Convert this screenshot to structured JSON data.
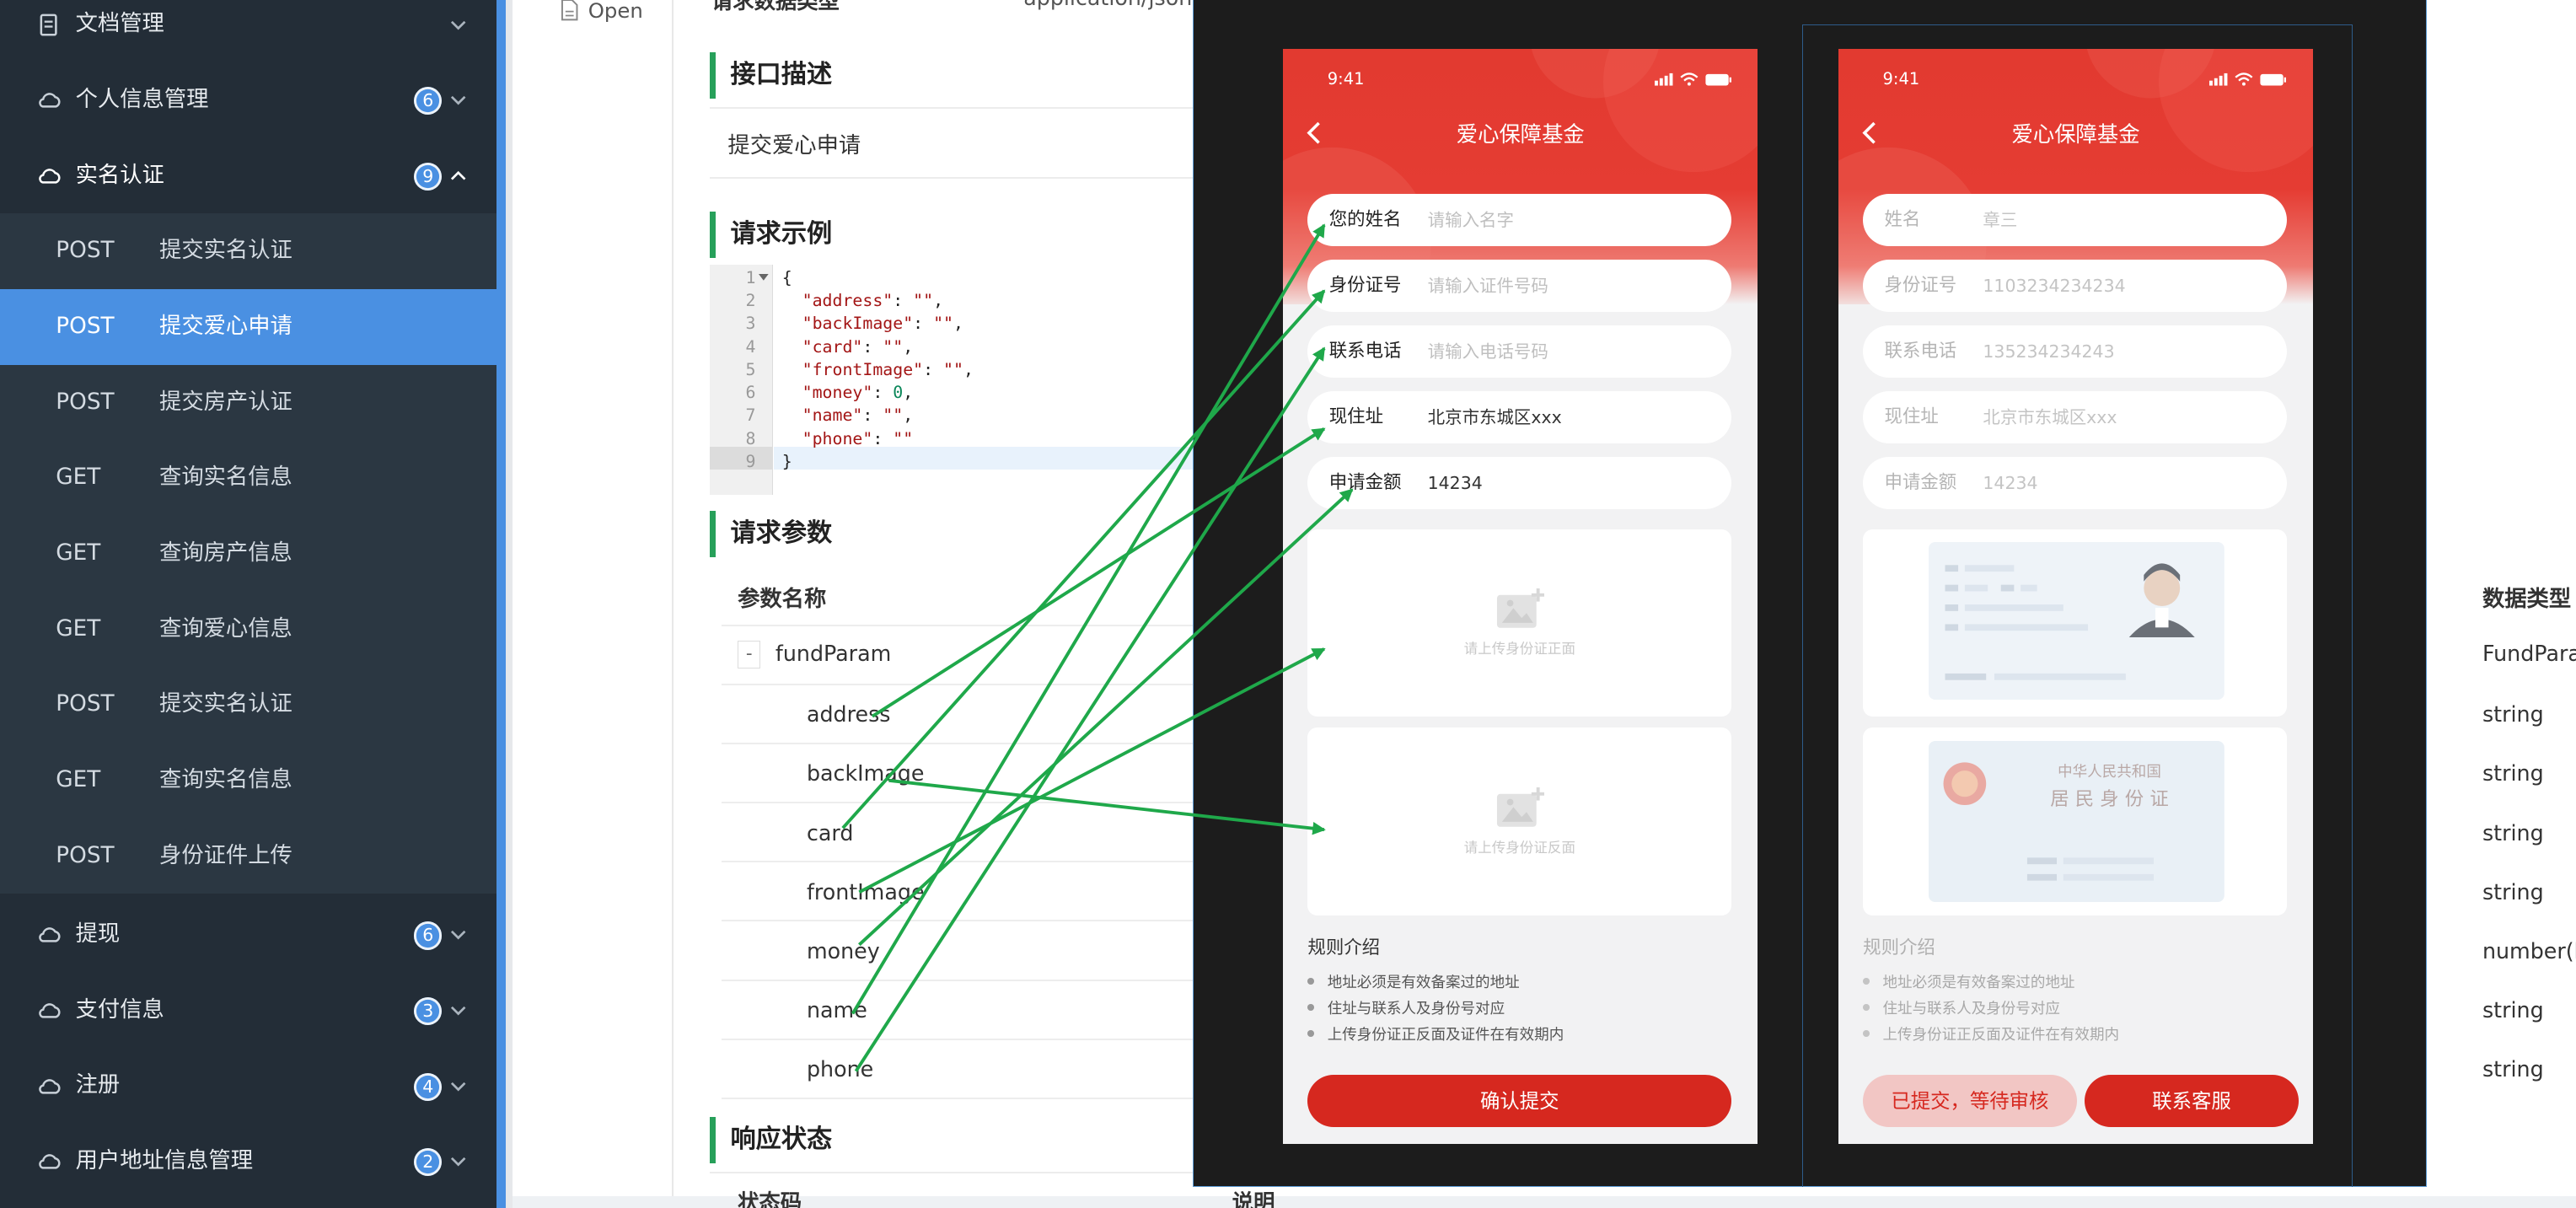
{
  "sidebar": {
    "groups": [
      {
        "label": "文档管理",
        "badge": null
      },
      {
        "label": "个人信息管理",
        "badge": "6"
      },
      {
        "label": "实名认证",
        "badge": "9"
      },
      {
        "label": "提现",
        "badge": "6"
      },
      {
        "label": "支付信息",
        "badge": "3"
      },
      {
        "label": "注册",
        "badge": "4"
      },
      {
        "label": "用户地址信息管理",
        "badge": "2"
      }
    ],
    "items": [
      {
        "method": "POST",
        "label": "提交实名认证"
      },
      {
        "method": "POST",
        "label": "提交爱心申请"
      },
      {
        "method": "POST",
        "label": "提交房产认证"
      },
      {
        "method": "GET",
        "label": "查询实名信息"
      },
      {
        "method": "GET",
        "label": "查询房产信息"
      },
      {
        "method": "GET",
        "label": "查询爱心信息"
      },
      {
        "method": "POST",
        "label": "提交实名认证"
      },
      {
        "method": "GET",
        "label": "查询实名信息"
      },
      {
        "method": "POST",
        "label": "身份证件上传"
      }
    ]
  },
  "doc": {
    "open_label": "Open",
    "req_type_label": "请求数据类型",
    "req_type_value": "application/json",
    "desc_title": "接口描述",
    "desc_text": "提交爱心申请",
    "example_title": "请求示例",
    "params_title": "请求参数",
    "param_name_header": "参数名称",
    "data_type_header": "数据类型",
    "response_title": "响应状态",
    "status_code_header": "状态码",
    "desc_header": "说明",
    "params": [
      {
        "name": "fundParam",
        "type": "FundParam"
      },
      {
        "name": "address",
        "type": "string"
      },
      {
        "name": "backImage",
        "type": "string"
      },
      {
        "name": "card",
        "type": "string"
      },
      {
        "name": "frontImage",
        "type": "string"
      },
      {
        "name": "money",
        "type": "number(b"
      },
      {
        "name": "name",
        "type": "string"
      },
      {
        "name": "phone",
        "type": "string"
      }
    ],
    "code_line_numbers": [
      "1",
      "2",
      "3",
      "4",
      "5",
      "6",
      "7",
      "8",
      "9"
    ]
  },
  "phone_left": {
    "time": "9:41",
    "title": "爱心保障基金",
    "fields": [
      {
        "label": "您的姓名",
        "value": "请输入名字"
      },
      {
        "label": "身份证号",
        "value": "请输入证件号码"
      },
      {
        "label": "联系电话",
        "value": "请输入电话号码"
      },
      {
        "label": "现住址",
        "value": "北京市东城区xxx"
      },
      {
        "label": "申请金额",
        "value": "14234"
      }
    ],
    "upload_front": "请上传身份证正面",
    "upload_back": "请上传身份证反面",
    "rules_title": "规则介绍",
    "rules": [
      "地址必须是有效备案过的地址",
      "住址与联系人及身份号对应",
      "上传身份证正反面及证件在有效期内"
    ],
    "submit": "确认提交"
  },
  "phone_right": {
    "time": "9:41",
    "title": "爱心保障基金",
    "fields": [
      {
        "label": "姓名",
        "value": "章三"
      },
      {
        "label": "身份证号",
        "value": "1103234234234"
      },
      {
        "label": "联系电话",
        "value": "135234234243"
      },
      {
        "label": "现住址",
        "value": "北京市东城区xxx"
      },
      {
        "label": "申请金额",
        "value": "14234"
      }
    ],
    "id_back_line1": "中华人民共和国",
    "id_back_line2": "居 民 身 份 证",
    "rules_title": "规则介绍",
    "rules": [
      "地址必须是有效备案过的地址",
      "住址与联系人及身份号对应",
      "上传身份证正反面及证件在有效期内"
    ],
    "status_btn": "已提交，等待审核",
    "service_btn": "联系客服"
  },
  "colors": {
    "sidebar_bg": "#232d37",
    "accent_blue": "#4a90e2",
    "brand_red": "#d6281f",
    "section_green": "#27a05a",
    "arrow_green": "#1fa84a"
  }
}
